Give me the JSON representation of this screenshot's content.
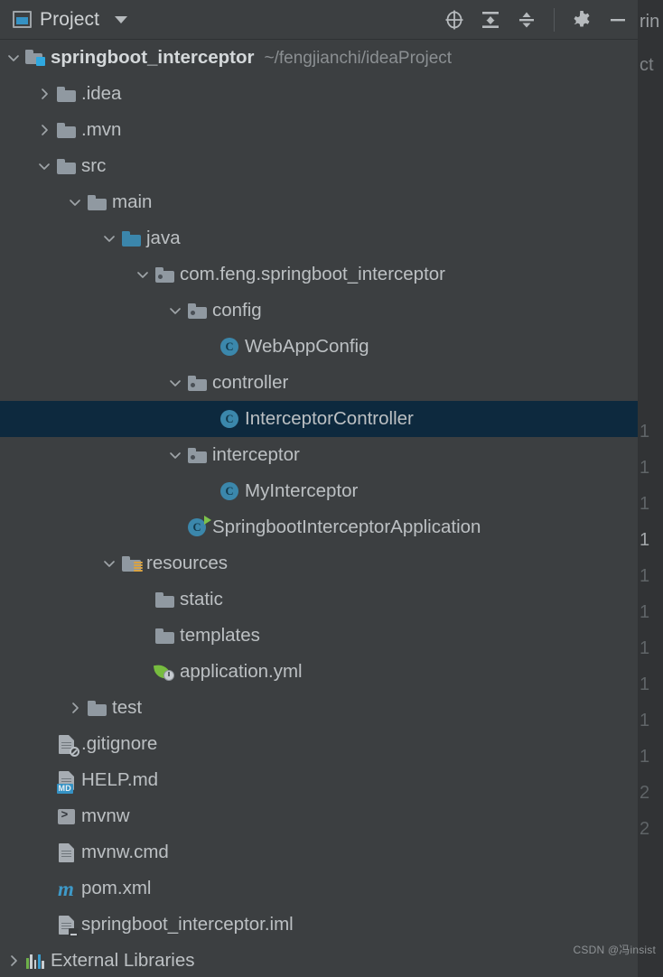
{
  "toolbar": {
    "title": "Project",
    "project_icon": "project-panel-icon",
    "dropdown_icon": "chevron-down-icon",
    "actions": [
      {
        "name": "select-opened-file-icon",
        "label": "Select Opened File"
      },
      {
        "name": "expand-all-icon",
        "label": "Expand All"
      },
      {
        "name": "collapse-all-icon",
        "label": "Collapse All"
      },
      {
        "name": "settings-gear-icon",
        "label": "Settings"
      },
      {
        "name": "hide-icon",
        "label": "Hide"
      }
    ]
  },
  "tree": {
    "rows": [
      {
        "label": "springboot_interceptor",
        "path": "~/fengjianchi/ideaProject",
        "icon": "module-icon",
        "arrow": "expanded",
        "indent": 0,
        "bold": true,
        "selected": false,
        "name": "tree-item-springboot-interceptor"
      },
      {
        "label": ".idea",
        "path": "",
        "icon": "folder-icon",
        "arrow": "collapsed",
        "indent": 1,
        "bold": false,
        "selected": false,
        "name": "tree-item-idea"
      },
      {
        "label": ".mvn",
        "path": "",
        "icon": "folder-icon",
        "arrow": "collapsed",
        "indent": 1,
        "bold": false,
        "selected": false,
        "name": "tree-item-mvn"
      },
      {
        "label": "src",
        "path": "",
        "icon": "folder-icon",
        "arrow": "expanded",
        "indent": 1,
        "bold": false,
        "selected": false,
        "name": "tree-item-src"
      },
      {
        "label": "main",
        "path": "",
        "icon": "folder-icon",
        "arrow": "expanded",
        "indent": 2,
        "bold": false,
        "selected": false,
        "name": "tree-item-main"
      },
      {
        "label": "java",
        "path": "",
        "icon": "source-folder-icon",
        "arrow": "expanded",
        "indent": 3,
        "bold": false,
        "selected": false,
        "name": "tree-item-java"
      },
      {
        "label": "com.feng.springboot_interceptor",
        "path": "",
        "icon": "package-icon",
        "arrow": "expanded",
        "indent": 4,
        "bold": false,
        "selected": false,
        "name": "tree-item-package-root"
      },
      {
        "label": "config",
        "path": "",
        "icon": "package-icon",
        "arrow": "expanded",
        "indent": 5,
        "bold": false,
        "selected": false,
        "name": "tree-item-config"
      },
      {
        "label": "WebAppConfig",
        "path": "",
        "icon": "java-class-icon",
        "arrow": "none",
        "indent": 6,
        "bold": false,
        "selected": false,
        "name": "tree-item-webappconfig"
      },
      {
        "label": "controller",
        "path": "",
        "icon": "package-icon",
        "arrow": "expanded",
        "indent": 5,
        "bold": false,
        "selected": false,
        "name": "tree-item-controller"
      },
      {
        "label": "InterceptorController",
        "path": "",
        "icon": "java-class-icon",
        "arrow": "none",
        "indent": 6,
        "bold": false,
        "selected": true,
        "name": "tree-item-interceptorcontroller"
      },
      {
        "label": "interceptor",
        "path": "",
        "icon": "package-icon",
        "arrow": "expanded",
        "indent": 5,
        "bold": false,
        "selected": false,
        "name": "tree-item-interceptor"
      },
      {
        "label": "MyInterceptor",
        "path": "",
        "icon": "java-class-icon",
        "arrow": "none",
        "indent": 6,
        "bold": false,
        "selected": false,
        "name": "tree-item-myinterceptor"
      },
      {
        "label": "SpringbootInterceptorApplication",
        "path": "",
        "icon": "java-class-runnable-icon",
        "arrow": "none",
        "indent": 5,
        "bold": false,
        "selected": false,
        "name": "tree-item-springbootinterceptorapplication"
      },
      {
        "label": "resources",
        "path": "",
        "icon": "resources-folder-icon",
        "arrow": "expanded",
        "indent": 3,
        "bold": false,
        "selected": false,
        "name": "tree-item-resources"
      },
      {
        "label": "static",
        "path": "",
        "icon": "folder-icon",
        "arrow": "none",
        "indent": 4,
        "bold": false,
        "selected": false,
        "name": "tree-item-static"
      },
      {
        "label": "templates",
        "path": "",
        "icon": "folder-icon",
        "arrow": "none",
        "indent": 4,
        "bold": false,
        "selected": false,
        "name": "tree-item-templates"
      },
      {
        "label": "application.yml",
        "path": "",
        "icon": "spring-yaml-icon",
        "arrow": "none",
        "indent": 4,
        "bold": false,
        "selected": false,
        "name": "tree-item-application-yml"
      },
      {
        "label": "test",
        "path": "",
        "icon": "folder-icon",
        "arrow": "collapsed",
        "indent": 2,
        "bold": false,
        "selected": false,
        "name": "tree-item-test"
      },
      {
        "label": ".gitignore",
        "path": "",
        "icon": "gitignore-file-icon",
        "arrow": "none",
        "indent": 1,
        "bold": false,
        "selected": false,
        "name": "tree-item-gitignore"
      },
      {
        "label": "HELP.md",
        "path": "",
        "icon": "markdown-file-icon",
        "arrow": "none",
        "indent": 1,
        "bold": false,
        "selected": false,
        "name": "tree-item-help-md"
      },
      {
        "label": "mvnw",
        "path": "",
        "icon": "shell-script-icon",
        "arrow": "none",
        "indent": 1,
        "bold": false,
        "selected": false,
        "name": "tree-item-mvnw"
      },
      {
        "label": "mvnw.cmd",
        "path": "",
        "icon": "text-file-icon",
        "arrow": "none",
        "indent": 1,
        "bold": false,
        "selected": false,
        "name": "tree-item-mvnw-cmd"
      },
      {
        "label": "pom.xml",
        "path": "",
        "icon": "maven-file-icon",
        "arrow": "none",
        "indent": 1,
        "bold": false,
        "selected": false,
        "name": "tree-item-pom-xml"
      },
      {
        "label": "springboot_interceptor.iml",
        "path": "",
        "icon": "iml-file-icon",
        "arrow": "none",
        "indent": 1,
        "bold": false,
        "selected": false,
        "name": "tree-item-iml"
      },
      {
        "label": "External Libraries",
        "path": "",
        "icon": "external-libraries-icon",
        "arrow": "collapsed",
        "indent": 0,
        "bold": false,
        "selected": false,
        "name": "tree-item-external-libraries"
      }
    ]
  },
  "editor_gutter": {
    "line_numbers": [
      {
        "value": "1",
        "current": false
      },
      {
        "value": "1",
        "current": false
      },
      {
        "value": "1",
        "current": false
      },
      {
        "value": "1",
        "current": true
      },
      {
        "value": "1",
        "current": false
      },
      {
        "value": "1",
        "current": false
      },
      {
        "value": "1",
        "current": false
      },
      {
        "value": "1",
        "current": false
      },
      {
        "value": "1",
        "current": false
      },
      {
        "value": "1",
        "current": false
      },
      {
        "value": "2",
        "current": false
      },
      {
        "value": "2",
        "current": false
      }
    ],
    "top_text": "rin",
    "bottom_text": "ct"
  },
  "watermark": {
    "text": "CSDN @冯insist"
  },
  "colors": {
    "panel_bg": "#3c3f41",
    "editor_bg": "#313335",
    "selection_bg": "#0d293e",
    "text": "#bcc0c3",
    "muted_text": "#8b8f92",
    "accent_blue": "#3592c4",
    "folder_gray": "#9099a1",
    "source_folder_blue": "#3b86ab",
    "spring_green": "#77bc3f",
    "resources_orange": "#d9a343"
  }
}
